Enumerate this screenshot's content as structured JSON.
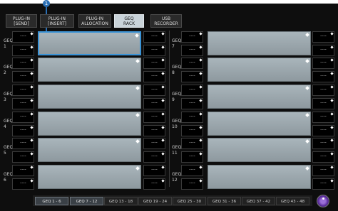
{
  "tabs": [
    {
      "label": "PLUG-IN\n[SEND]",
      "active": false
    },
    {
      "label": "PLUG-IN\n[INSERT]",
      "active": false
    },
    {
      "label": "PLUG-IN\nALLOCATION",
      "active": false
    },
    {
      "label": "GEQ\nRACK",
      "active": true
    },
    {
      "label": "USB\nRECORDER",
      "active": false
    }
  ],
  "callout": "1",
  "geq_left": [
    "GEQ\n1",
    "GEQ\n2",
    "GEQ\n3",
    "GEQ\n4",
    "GEQ\n5",
    "GEQ\n6"
  ],
  "geq_right": [
    "GEQ\n7",
    "GEQ\n8",
    "GEQ\n9",
    "GEQ\n10",
    "GEQ\n11",
    "GEQ\n12"
  ],
  "slot_value": "----",
  "bottom_tabs": [
    {
      "label": "GEQ 1 - 6",
      "active": true
    },
    {
      "label": "GEQ 7 - 12",
      "active": true
    },
    {
      "label": "GEQ 13 - 18",
      "active": false
    },
    {
      "label": "GEQ 19 - 24",
      "active": false
    },
    {
      "label": "GEQ 25 - 30",
      "active": false
    },
    {
      "label": "GEQ 31 - 36",
      "active": false
    },
    {
      "label": "GEQ 37 - 42",
      "active": false
    },
    {
      "label": "GEQ 43 - 48",
      "active": false
    }
  ],
  "colors": {
    "accent": "#3a93d6",
    "panel": "#a9b5bb",
    "background": "#0e0e0e"
  },
  "icons": {
    "knob": "rotary-knob-icon"
  }
}
